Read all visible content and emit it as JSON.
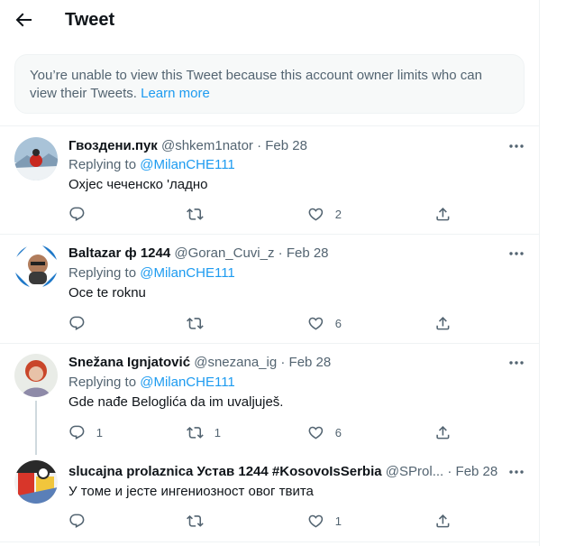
{
  "header": {
    "title": "Tweet"
  },
  "notice": {
    "text": "You’re unable to view this Tweet because this account owner limits who can view their Tweets.",
    "link": "Learn more"
  },
  "replies": [
    {
      "name": "Гвоздени.пук",
      "handle": "@shkem1nator",
      "sep": "·",
      "date": "Feb 28",
      "replying_prefix": "Replying to",
      "replying_to": "@MilanCHE111",
      "text": "Охјес чеченско 'ладно",
      "reply_count": "",
      "retweet_count": "",
      "like_count": "2"
    },
    {
      "name": "Baltazar ф 1244",
      "handle": "@Goran_Cuvi_z",
      "sep": "·",
      "date": "Feb 28",
      "replying_prefix": "Replying to",
      "replying_to": "@MilanCHE111",
      "text": "Oce te roknu",
      "reply_count": "",
      "retweet_count": "",
      "like_count": "6"
    },
    {
      "name": "Snežana Ignjatović",
      "handle": "@snezana_ig",
      "sep": "·",
      "date": "Feb 28",
      "replying_prefix": "Replying to",
      "replying_to": "@MilanCHE111",
      "text": "Gde nađe Beloglića da im uvaljuješ.",
      "reply_count": "1",
      "retweet_count": "1",
      "like_count": "6"
    },
    {
      "name": "slucajna prolaznica Устав 1244 #KosovoIsSerbia",
      "handle": "@SProl...",
      "sep": "·",
      "date": "Feb 28",
      "text": "У томе и јесте ингениозност овог твита",
      "reply_count": "",
      "retweet_count": "",
      "like_count": "1"
    }
  ],
  "colors": {
    "accent": "#1d9bf0",
    "secondary_text": "#536471",
    "border": "#eff3f4"
  }
}
